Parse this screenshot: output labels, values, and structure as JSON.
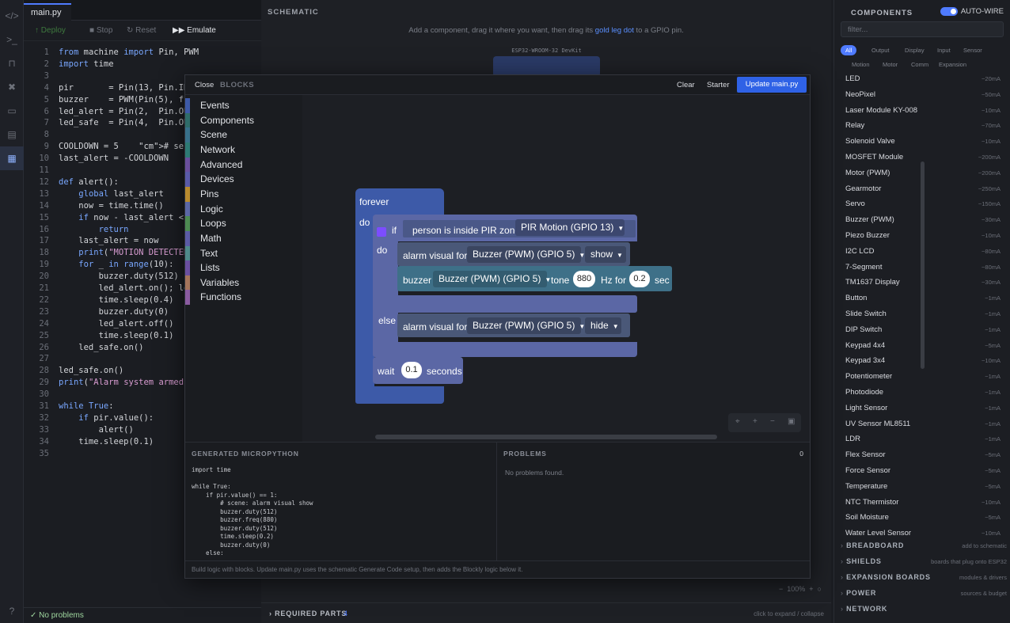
{
  "editor": {
    "tab": "main.py",
    "toolbar": {
      "deploy": "Deploy",
      "stop": "Stop",
      "reset": "Reset",
      "emulate": "Emulate"
    },
    "lines": [
      {
        "n": "1",
        "t": "from machine import Pin, PWM"
      },
      {
        "n": "2",
        "t": "import time"
      },
      {
        "n": "3",
        "t": ""
      },
      {
        "n": "4",
        "t": "pir       = Pin(13, Pin.IN)"
      },
      {
        "n": "5",
        "t": "buzzer    = PWM(Pin(5), fre"
      },
      {
        "n": "6",
        "t": "led_alert = Pin(2,  Pin.OUT"
      },
      {
        "n": "7",
        "t": "led_safe  = Pin(4,  Pin.OUT"
      },
      {
        "n": "8",
        "t": ""
      },
      {
        "n": "9",
        "t": "COOLDOWN = 5    # seconds b"
      },
      {
        "n": "10",
        "t": "last_alert = -COOLDOWN"
      },
      {
        "n": "11",
        "t": ""
      },
      {
        "n": "12",
        "t": "def alert():"
      },
      {
        "n": "13",
        "t": "    global last_alert"
      },
      {
        "n": "14",
        "t": "    now = time.time()"
      },
      {
        "n": "15",
        "t": "    if now - last_alert < C"
      },
      {
        "n": "16",
        "t": "        return"
      },
      {
        "n": "17",
        "t": "    last_alert = now"
      },
      {
        "n": "18",
        "t": "    print(\"MOTION DETECTED"
      },
      {
        "n": "19",
        "t": "    for _ in range(10):"
      },
      {
        "n": "20",
        "t": "        buzzer.duty(512)"
      },
      {
        "n": "21",
        "t": "        led_alert.on(); led"
      },
      {
        "n": "22",
        "t": "        time.sleep(0.4)"
      },
      {
        "n": "23",
        "t": "        buzzer.duty(0)"
      },
      {
        "n": "24",
        "t": "        led_alert.off()"
      },
      {
        "n": "25",
        "t": "        time.sleep(0.1)"
      },
      {
        "n": "26",
        "t": "    led_safe.on()"
      },
      {
        "n": "27",
        "t": ""
      },
      {
        "n": "28",
        "t": "led_safe.on()"
      },
      {
        "n": "29",
        "t": "print(\"Alarm system armed."
      },
      {
        "n": "30",
        "t": ""
      },
      {
        "n": "31",
        "t": "while True:"
      },
      {
        "n": "32",
        "t": "    if pir.value():"
      },
      {
        "n": "33",
        "t": "        alert()"
      },
      {
        "n": "34",
        "t": "    time.sleep(0.1)"
      },
      {
        "n": "35",
        "t": ""
      }
    ],
    "status": "No problems"
  },
  "schematic": {
    "title": "SCHEMATIC",
    "hint_a": "Add a component, drag it where you want, then drag its ",
    "hint_link": "gold leg dot",
    "hint_b": " to a GPIO pin.",
    "board_label": "ESP32-WROOM-32 DevKit",
    "required_parts": "REQUIRED PARTS",
    "required_count": "4",
    "expand_hint": "click to expand / collapse",
    "zoom": "100%"
  },
  "components": {
    "title": "COMPONENTS",
    "autowire": "AUTO-WIRE",
    "filter_placeholder": "filter...",
    "chips": [
      "All",
      "Output",
      "Display",
      "Input",
      "Sensor",
      "Motion",
      "Motor",
      "Comm",
      "Expansion"
    ],
    "items": [
      {
        "name": "LED",
        "cur": "~20mA"
      },
      {
        "name": "NeoPixel",
        "cur": "~50mA"
      },
      {
        "name": "Laser Module KY-008",
        "cur": "~10mA"
      },
      {
        "name": "Relay",
        "cur": "~70mA"
      },
      {
        "name": "Solenoid Valve",
        "cur": "~10mA"
      },
      {
        "name": "MOSFET Module",
        "cur": "~200mA"
      },
      {
        "name": "Motor (PWM)",
        "cur": "~200mA"
      },
      {
        "name": "Gearmotor",
        "cur": "~250mA"
      },
      {
        "name": "Servo",
        "cur": "~150mA"
      },
      {
        "name": "Buzzer (PWM)",
        "cur": "~30mA"
      },
      {
        "name": "Piezo Buzzer",
        "cur": "~10mA"
      },
      {
        "name": "I2C LCD",
        "cur": "~80mA"
      },
      {
        "name": "7-Segment",
        "cur": "~80mA"
      },
      {
        "name": "TM1637 Display",
        "cur": "~30mA"
      },
      {
        "name": "Button",
        "cur": "~1mA"
      },
      {
        "name": "Slide Switch",
        "cur": "~1mA"
      },
      {
        "name": "DIP Switch",
        "cur": "~1mA"
      },
      {
        "name": "Keypad 4x4",
        "cur": "~5mA"
      },
      {
        "name": "Keypad 3x4",
        "cur": "~10mA"
      },
      {
        "name": "Potentiometer",
        "cur": "~1mA"
      },
      {
        "name": "Photodiode",
        "cur": "~1mA"
      },
      {
        "name": "Light Sensor",
        "cur": "~1mA"
      },
      {
        "name": "UV Sensor ML8511",
        "cur": "~1mA"
      },
      {
        "name": "LDR",
        "cur": "~1mA"
      },
      {
        "name": "Flex Sensor",
        "cur": "~5mA"
      },
      {
        "name": "Force Sensor",
        "cur": "~5mA"
      },
      {
        "name": "Temperature",
        "cur": "~5mA"
      },
      {
        "name": "NTC Thermistor",
        "cur": "~10mA"
      },
      {
        "name": "Soil Moisture",
        "cur": "~5mA"
      },
      {
        "name": "Water Level Sensor",
        "cur": "~10mA"
      }
    ],
    "sections": [
      {
        "name": "BREADBOARD",
        "hint": "add to schematic"
      },
      {
        "name": "SHIELDS",
        "hint": "boards that plug onto ESP32"
      },
      {
        "name": "EXPANSION BOARDS",
        "hint": "modules & drivers"
      },
      {
        "name": "POWER",
        "hint": "sources & budget"
      },
      {
        "name": "NETWORK",
        "hint": ""
      }
    ]
  },
  "blocks": {
    "close": "Close",
    "title": "BLOCKS",
    "clear": "Clear",
    "starter": "Starter",
    "update": "Update main.py",
    "categories": [
      {
        "name": "Events",
        "color": "#3d5aa8"
      },
      {
        "name": "Components",
        "color": "#2f6c6a"
      },
      {
        "name": "Scene",
        "color": "#38708a"
      },
      {
        "name": "Network",
        "color": "#2e7a74"
      },
      {
        "name": "Advanced",
        "color": "#6a4f9c"
      },
      {
        "name": "Devices",
        "color": "#5a5aa8"
      },
      {
        "name": "Pins",
        "color": "#b88a2e"
      },
      {
        "name": "Logic",
        "color": "#5b67a5"
      },
      {
        "name": "Loops",
        "color": "#4d8a52"
      },
      {
        "name": "Math",
        "color": "#5b5ba5"
      },
      {
        "name": "Text",
        "color": "#4f8a8a"
      },
      {
        "name": "Lists",
        "color": "#6a4fa0"
      },
      {
        "name": "Variables",
        "color": "#a5745b"
      },
      {
        "name": "Functions",
        "color": "#8a5ba0"
      }
    ],
    "forever": "forever",
    "do": "do",
    "if": "if",
    "pir_cond": "person is inside PIR zone",
    "pir_sensor": "PIR Motion (GPIO 13)",
    "do2": "do",
    "alarm_visual": "alarm visual for",
    "buzzer_dev": "Buzzer (PWM) (GPIO 5)",
    "show": "show",
    "buzzer": "buzzer",
    "tone": "tone",
    "freq": "880",
    "hz_for": "Hz for",
    "secs": "0.2",
    "sec": "sec",
    "else": "else",
    "hide": "hide",
    "wait": "wait",
    "wait_val": "0.1",
    "seconds": "seconds",
    "gen_title": "GENERATED MICROPYTHON",
    "gen_code": "import time\n\nwhile True:\n    if pir.value() == 1:\n        # scene: alarm visual show\n        buzzer.duty(512)\n        buzzer.freq(880)\n        buzzer.duty(512)\n        time.sleep(0.2)\n        buzzer.duty(0)\n    else:",
    "problems_title": "PROBLEMS",
    "problems_count": "0",
    "no_problems": "No problems found.",
    "footer": "Build logic with blocks. Update main.py uses the schematic Generate Code setup, then adds the Blockly logic below it."
  },
  "colors": {
    "accent": "#4f7bff",
    "event_block": "#3d5aa8",
    "logic_block": "#5b67a5",
    "scene_block": "#4a5878"
  }
}
